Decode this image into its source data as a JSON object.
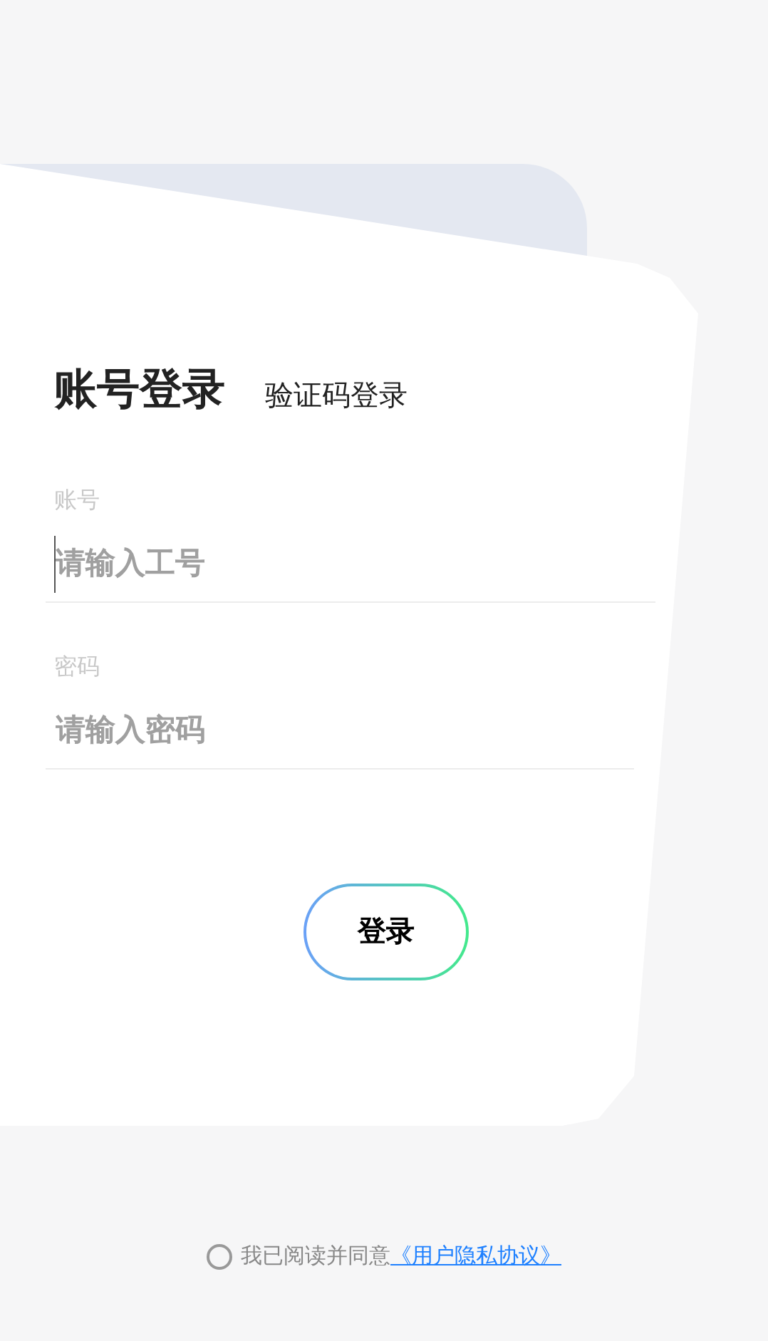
{
  "tabs": [
    {
      "label": "账号登录",
      "selected": true
    },
    {
      "label": "验证码登录",
      "selected": false
    }
  ],
  "fields": [
    {
      "label": "账号",
      "placeholder": "请输入工号",
      "focused": true
    },
    {
      "label": "密码",
      "placeholder": "请输入密码",
      "focused": false
    }
  ],
  "login_button": {
    "label": "登录"
  },
  "agreement": {
    "checked": false,
    "text": "我已阅读并同意",
    "link": "《用户隐私协议》"
  }
}
